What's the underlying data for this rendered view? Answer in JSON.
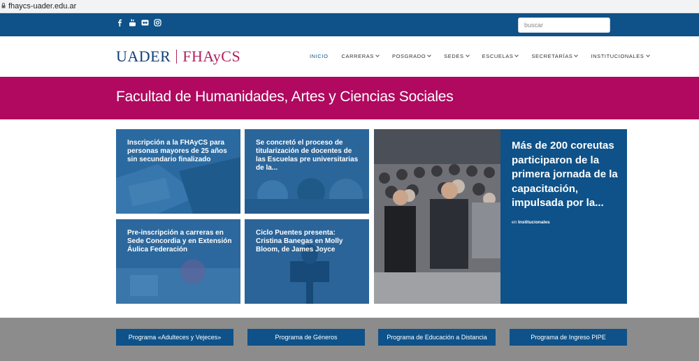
{
  "browser": {
    "url": "fhaycs-uader.edu.ar"
  },
  "topbar": {
    "social_icons": [
      "facebook-icon",
      "youtube-icon",
      "flickr-icon",
      "instagram-icon"
    ],
    "search_placeholder": "buscar"
  },
  "header": {
    "logo_left": "UADER",
    "logo_right": "FHAyCS",
    "nav": [
      {
        "label": "INICIO",
        "active": true
      },
      {
        "label": "CARRERAS"
      },
      {
        "label": "POSGRADO"
      },
      {
        "label": "SEDES"
      },
      {
        "label": "ESCUELAS"
      },
      {
        "label": "SECRETARÍAS"
      },
      {
        "label": "INSTITUCIONALES"
      }
    ]
  },
  "banner": {
    "title": "Facultad de Humanidades, Artes y Ciencias Sociales"
  },
  "news": [
    {
      "title": "Inscripción a la FHAyCS para personas mayores de 25 años sin secundario finalizado"
    },
    {
      "title": "Se concretó el proceso de titularización de docentes de las Escuelas pre universitarias de la..."
    },
    {
      "title": "Pre-inscripción a carreras en Sede Concordia y en Extensión Áulica Federación"
    },
    {
      "title": "Ciclo Puentes presenta: Cristina Banegas en Molly Bloom, de James Joyce"
    }
  ],
  "feature": {
    "title": "Más de 200 coreutas participaron de la primera jornada de la capacitación, impulsada por la...",
    "category_prefix": "en",
    "category": "Institucionales"
  },
  "programs": [
    {
      "label": "Programa «Adulteces y Vejeces»"
    },
    {
      "label": "Programa de Géneros"
    },
    {
      "label": "Programa de Educación a Distancia"
    },
    {
      "label": "Programa de Ingreso PIPE"
    }
  ],
  "colors": {
    "blue": "#0e5289",
    "magenta": "#b0095f",
    "gray": "#8c8c8c"
  }
}
